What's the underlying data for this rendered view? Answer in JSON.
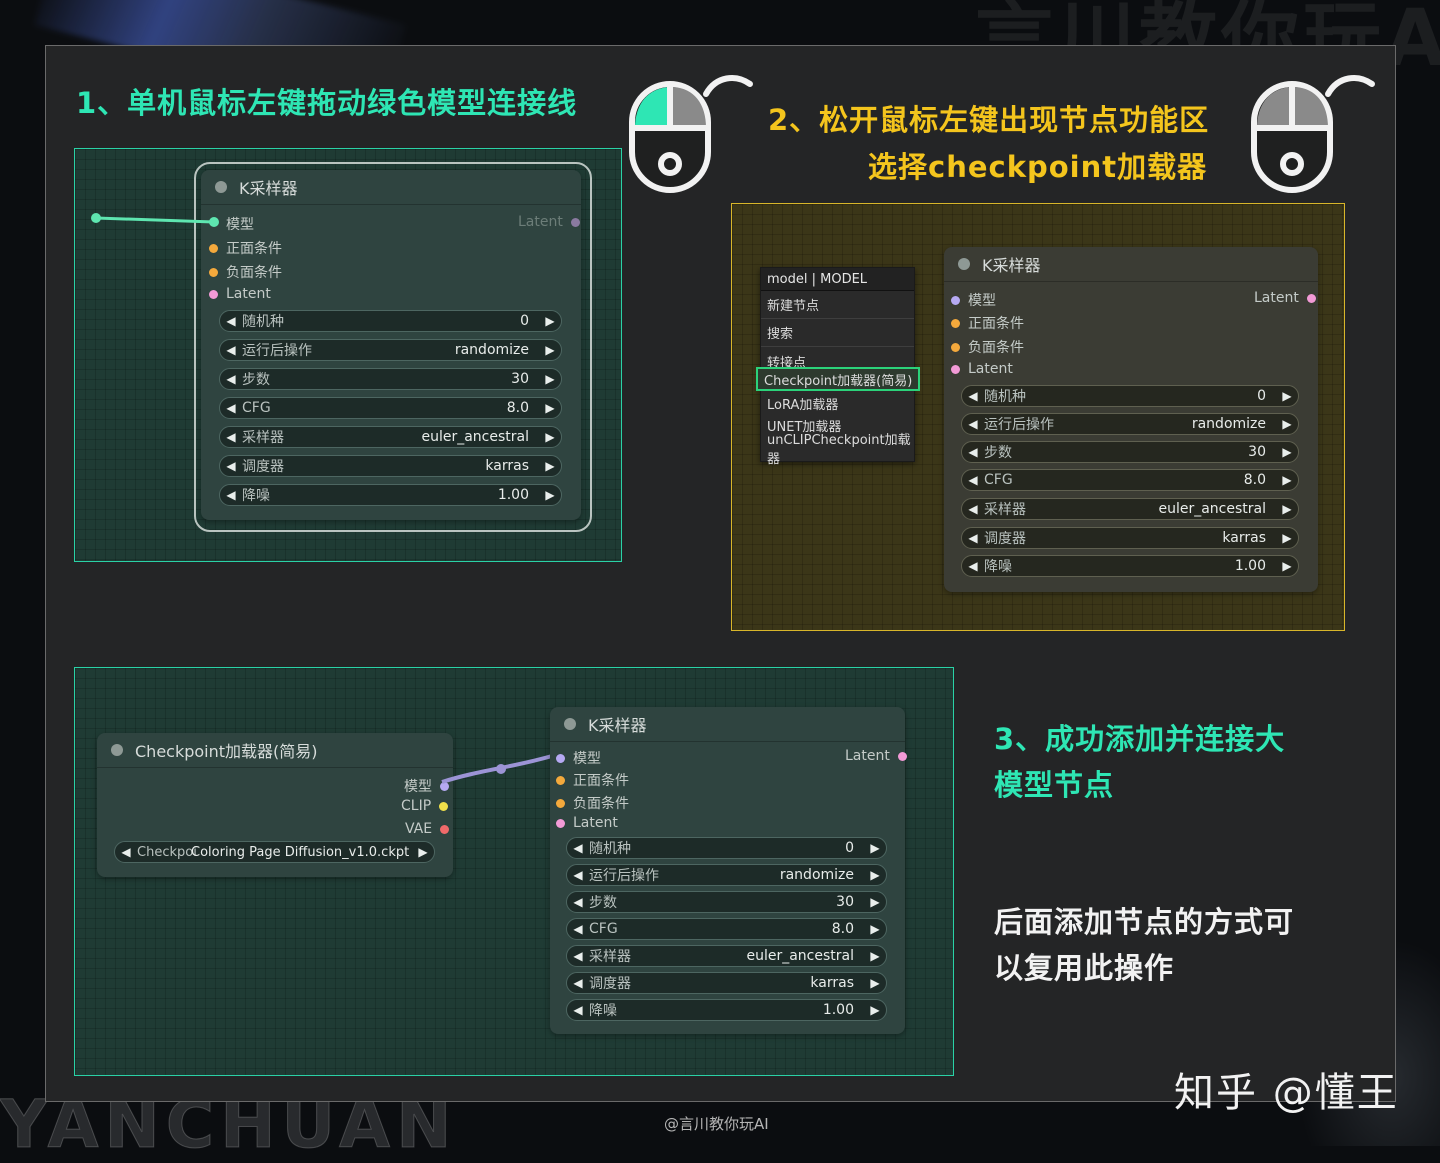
{
  "background": {
    "watermark_text": "言川教你玩AI",
    "bottom_text": "YANCHUAN"
  },
  "steps": {
    "step1": "1、单机鼠标左键拖动绿色模型连接线",
    "step2_line1": "2、松开鼠标左键出现节点功能区",
    "step2_line2": "选择checkpoint加载器",
    "step3_line1": "3、成功添加并连接大",
    "step3_line2": "模型节点",
    "note_line1": "后面添加节点的方式可",
    "note_line2": "以复用此操作"
  },
  "ksampler": {
    "title": "K采样器",
    "inputs": [
      "模型",
      "正面条件",
      "负面条件",
      "Latent"
    ],
    "output": "Latent",
    "widgets": [
      {
        "label": "随机种",
        "value": "0"
      },
      {
        "label": "运行后操作",
        "value": "randomize"
      },
      {
        "label": "步数",
        "value": "30"
      },
      {
        "label": "CFG",
        "value": "8.0"
      },
      {
        "label": "采样器",
        "value": "euler_ancestral"
      },
      {
        "label": "调度器",
        "value": "karras"
      },
      {
        "label": "降噪",
        "value": "1.00"
      }
    ]
  },
  "context_menu": {
    "title": "model | MODEL",
    "items": [
      "新建节点",
      "搜索",
      "转接点",
      "Checkpoint加载器(简易)",
      "LoRA加载器",
      "UNET加载器",
      "unCLIPCheckpoint加载器"
    ],
    "highlighted": "Checkpoint加载器(简易)"
  },
  "checkpoint_node": {
    "title": "Checkpoint加载器(简易)",
    "outputs": [
      "模型",
      "CLIP",
      "VAE"
    ],
    "widget_label": "Checkpoi",
    "widget_value": "Coloring Page Diffusion_v1.0.ckpt"
  },
  "footer": {
    "credit": "@言川教你玩AI",
    "zhihu": "知乎 @懂王"
  },
  "colors": {
    "green": "#2ee6b4",
    "yellow": "#f4c51d",
    "model_port": "#b6a9f2",
    "condition_port": "#f4a93c",
    "latent_port": "#f29ad6",
    "clip_port": "#f1e14a",
    "vae_port": "#f06a6a"
  },
  "icons": [
    "mouse-left-click-icon",
    "mouse-icon"
  ]
}
